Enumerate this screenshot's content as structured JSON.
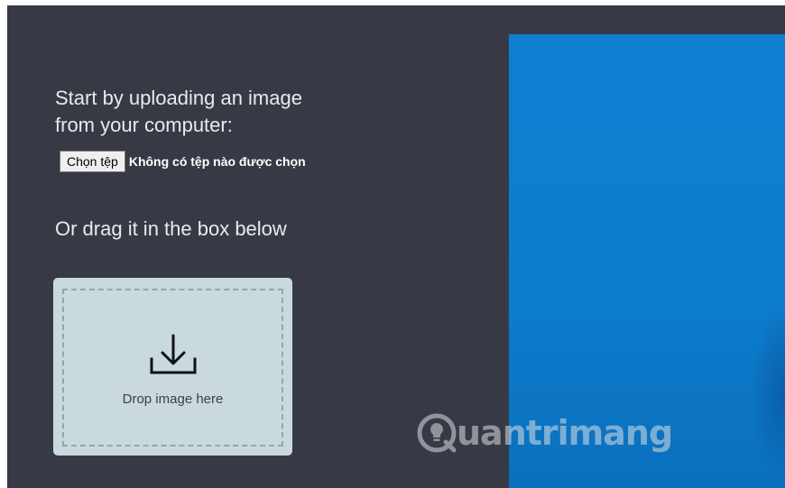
{
  "upload": {
    "intro_line1": "Start by uploading an image",
    "intro_line2": "from your computer:",
    "file_button_label": "Chọn tệp",
    "file_status": "Không có tệp nào được chọn"
  },
  "drag": {
    "heading": "Or drag it in the box below",
    "drop_label": "Drop image here",
    "icon": "download-icon"
  },
  "watermark": {
    "text": "uantrimang",
    "logo": "lightbulb-q-logo"
  },
  "colors": {
    "background": "#373a45",
    "drop_zone": "#c9d9dd",
    "preview_blue": "#0e7fd1",
    "text": "#e9eaec"
  }
}
